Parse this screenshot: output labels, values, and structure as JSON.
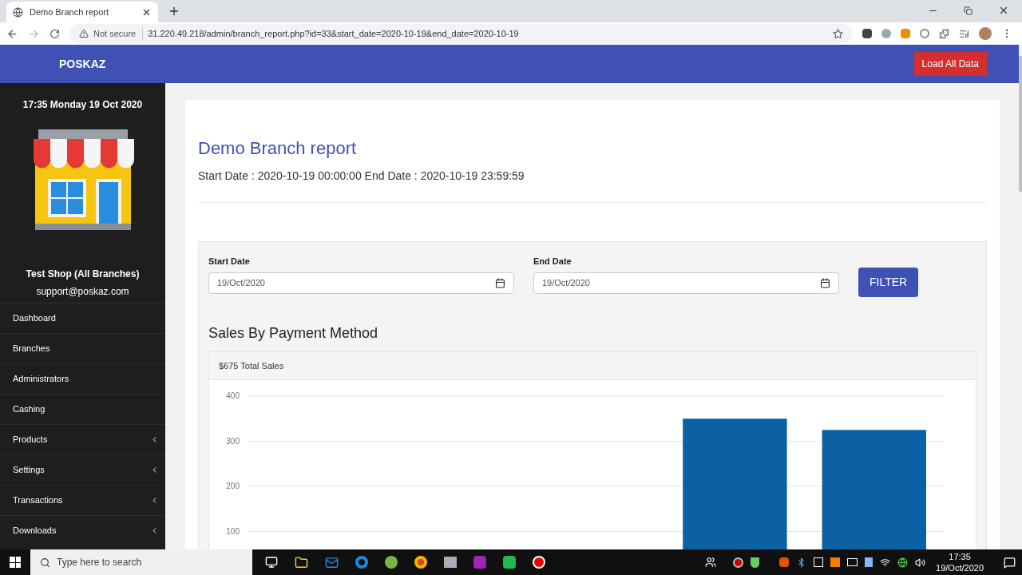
{
  "browser": {
    "tab_title": "Demo Branch report",
    "security": "Not secure",
    "url": "31.220.49.218/admin/branch_report.php?id=33&start_date=2020-10-19&end_date=2020-10-19"
  },
  "header": {
    "brand": "POSKAZ",
    "action": "Load All Data"
  },
  "sidebar": {
    "clock": "17:35 Monday 19 Oct 2020",
    "shop_name": "Test Shop (All Branches)",
    "email": "support@poskaz.com",
    "items": [
      {
        "label": "Dashboard",
        "submenu": false
      },
      {
        "label": "Branches",
        "submenu": false
      },
      {
        "label": "Administrators",
        "submenu": false
      },
      {
        "label": "Cashing",
        "submenu": false
      },
      {
        "label": "Products",
        "submenu": true
      },
      {
        "label": "Settings",
        "submenu": true
      },
      {
        "label": "Transactions",
        "submenu": true
      },
      {
        "label": "Downloads",
        "submenu": true
      }
    ]
  },
  "report": {
    "title": "Demo Branch report",
    "period": "Start Date : 2020-10-19 00:00:00 End Date : 2020-10-19 23:59:59"
  },
  "filter": {
    "fields": [
      {
        "label": "Start Date",
        "value": "19/Oct/2020"
      },
      {
        "label": "End Date",
        "value": "19/Oct/2020"
      }
    ],
    "button": "FILTER"
  },
  "sales": {
    "heading": "Sales By Payment Method",
    "total": "$675 Total Sales",
    "chart_data": {
      "type": "bar",
      "grid": true,
      "series": [
        {
          "color": "#0b61a4",
          "values": [
            0,
            0,
            0,
            350,
            325
          ]
        }
      ],
      "ylim": [
        0,
        400
      ],
      "yticks": [
        100,
        200,
        300,
        400
      ]
    }
  },
  "taskbar": {
    "search_placeholder": "Type here to search",
    "time": "17:35",
    "date": "19/Oct/2020"
  }
}
